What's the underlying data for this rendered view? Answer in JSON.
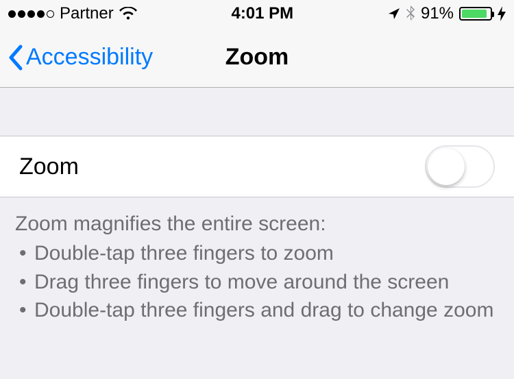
{
  "statusBar": {
    "carrier": "Partner",
    "time": "4:01 PM",
    "batteryPercent": "91%"
  },
  "nav": {
    "backLabel": "Accessibility",
    "title": "Zoom"
  },
  "cell": {
    "label": "Zoom",
    "toggleOn": false
  },
  "footer": {
    "title": "Zoom magnifies the entire screen:",
    "items": [
      "Double-tap three fingers to zoom",
      "Drag three fingers to move around the screen",
      "Double-tap three fingers and drag to change zoom"
    ]
  }
}
